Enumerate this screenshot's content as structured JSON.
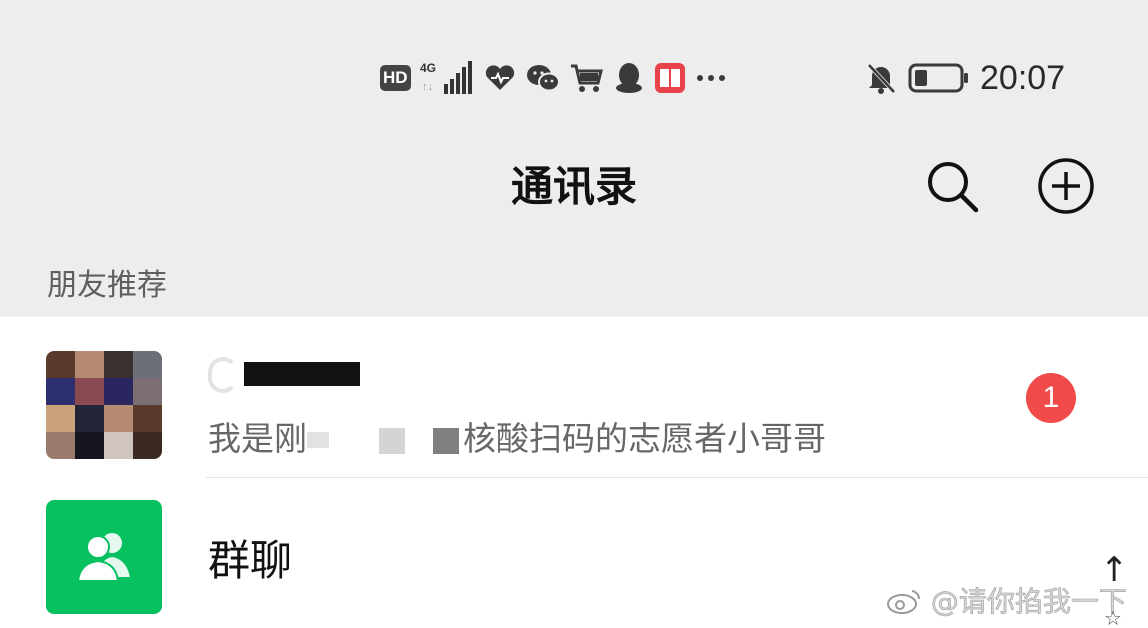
{
  "status_bar": {
    "hd": "HD",
    "network": "4G",
    "time": "20:07",
    "icons": [
      "hd-icon",
      "signal-icon",
      "health-icon",
      "wechat-icon",
      "cart-icon",
      "qq-icon",
      "book-app-icon",
      "more-dots-icon",
      "bell-muted-icon",
      "battery-icon"
    ]
  },
  "nav": {
    "title": "通讯录",
    "icons": [
      "search-icon",
      "add-circle-icon"
    ]
  },
  "section": {
    "label": "朋友推荐"
  },
  "contacts": {
    "recommend": {
      "message_start": "我是刚",
      "message_end": "核酸扫码的志愿者小哥哥",
      "badge": "1"
    },
    "group_chat": {
      "label": "群聊",
      "icon": "group-people-icon"
    }
  },
  "watermark": {
    "text": "@请你掐我一下",
    "arrow": "↑",
    "star": "☆"
  },
  "colors": {
    "background": "#ededed",
    "accent_green": "#07c160",
    "badge_red": "#f04a4a"
  }
}
